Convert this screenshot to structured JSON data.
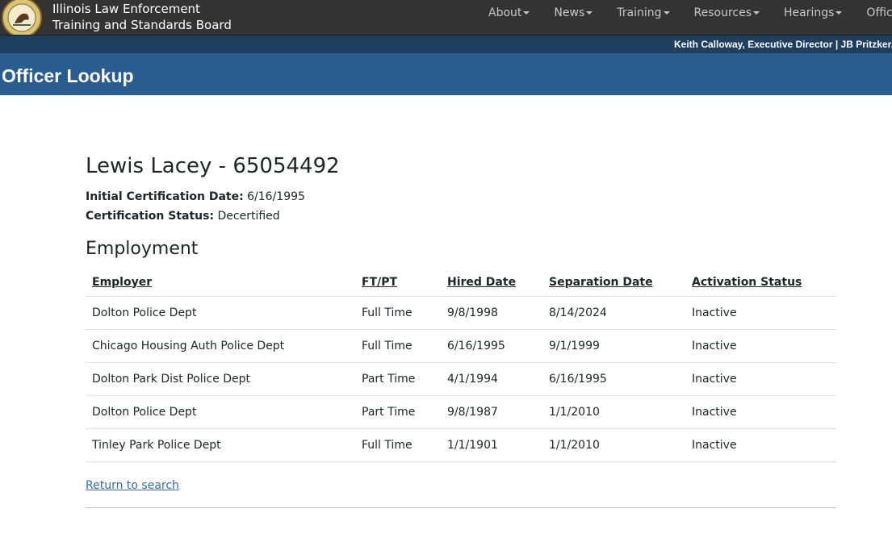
{
  "header": {
    "brand_line1": "Illinois Law Enforcement",
    "brand_line2": "Training and Standards Board",
    "nav": [
      {
        "label": "About"
      },
      {
        "label": "News"
      },
      {
        "label": "Training"
      },
      {
        "label": "Resources"
      },
      {
        "label": "Hearings"
      },
      {
        "label": "Officer Lo"
      }
    ],
    "subbar_text": "Keith Calloway, Executive Director | JB Pritzker, Go"
  },
  "page_title": "Officer Lookup",
  "officer": {
    "name_heading": "Lewis Lacey - 65054492",
    "initial_cert_label": "Initial Certification Date:",
    "initial_cert_value": "6/16/1995",
    "cert_status_label": "Certification Status:",
    "cert_status_value": "Decertified"
  },
  "employment": {
    "title": "Employment",
    "columns": [
      "Employer",
      "FT/PT",
      "Hired Date",
      "Separation Date",
      "Activation Status"
    ],
    "rows": [
      [
        "Dolton Police Dept",
        "Full Time",
        "9/8/1998",
        "8/14/2024",
        "Inactive"
      ],
      [
        "Chicago Housing Auth Police Dept",
        "Full Time",
        "6/16/1995",
        "9/1/1999",
        "Inactive"
      ],
      [
        "Dolton Park Dist Police Dept",
        "Part Time",
        "4/1/1994",
        "6/16/1995",
        "Inactive"
      ],
      [
        "Dolton Police Dept",
        "Part Time",
        "9/8/1987",
        "1/1/2010",
        "Inactive"
      ],
      [
        "Tinley Park Police Dept",
        "Full Time",
        "1/1/1901",
        "1/1/2010",
        "Inactive"
      ]
    ]
  },
  "return_link": "Return to search",
  "colors": {
    "navbar": "#333333",
    "subbar": "#1e3f5f",
    "title_band": "#2a5d8f",
    "link": "#2a6db5"
  }
}
